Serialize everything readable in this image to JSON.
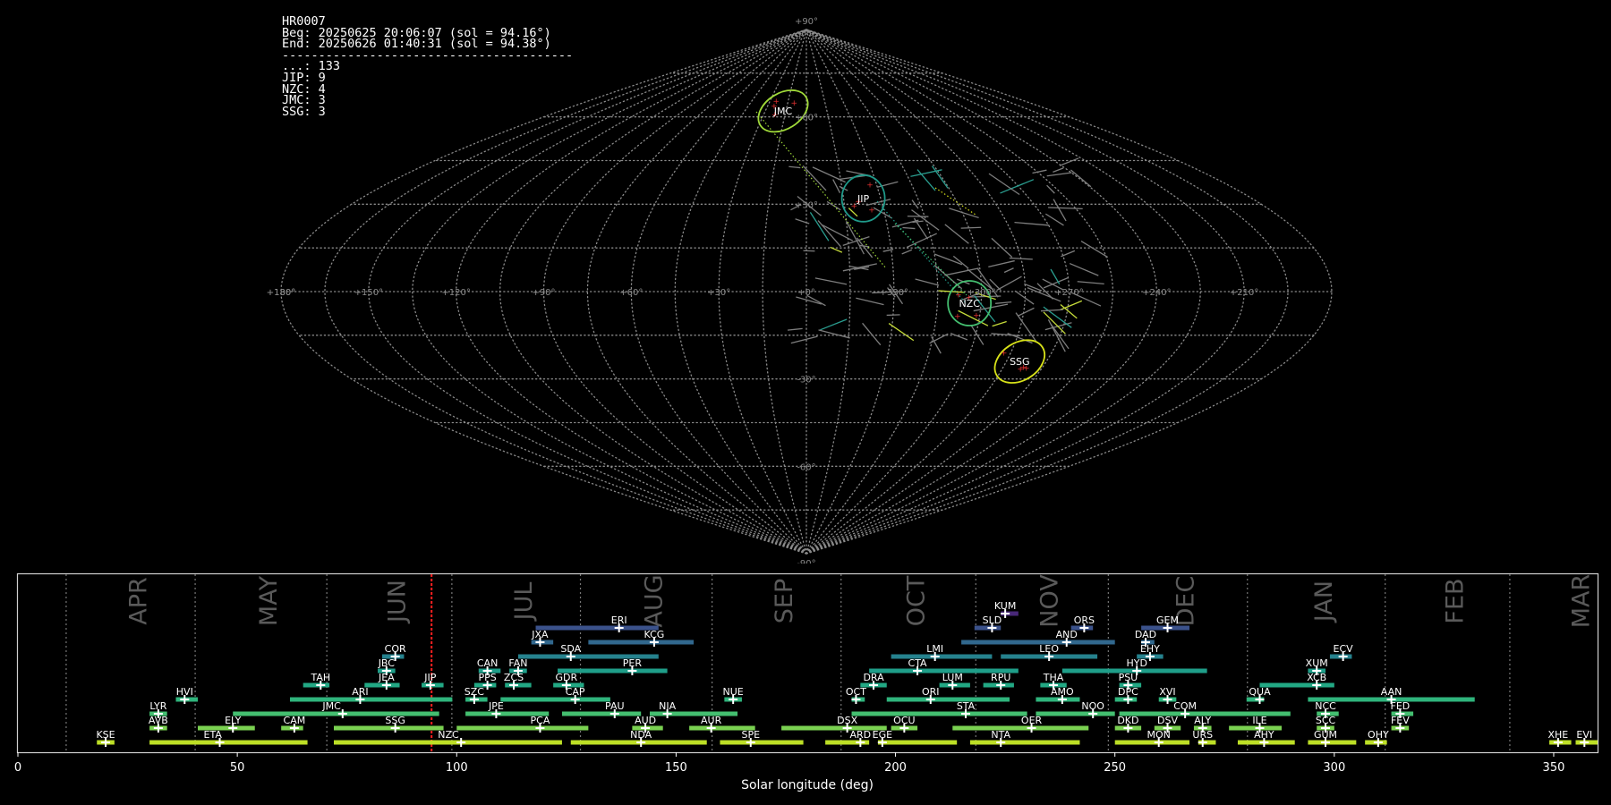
{
  "info": {
    "title": "HR0007",
    "beg": "Beg: 20250625 20:06:07 (sol = 94.16°)",
    "end": "End: 20250626 01:40:31 (sol = 94.38°)",
    "separator": "----------------------------------------",
    "counts": [
      {
        "label": "...",
        "value": 133
      },
      {
        "label": "JIP",
        "value": 9
      },
      {
        "label": "NZC",
        "value": 4
      },
      {
        "label": "JMC",
        "value": 3
      },
      {
        "label": "SSG",
        "value": 3
      }
    ]
  },
  "sky_map": {
    "projection": "sinusoidal",
    "lon_ticks": [
      "+180°",
      "+150°",
      "+120°",
      "+90°",
      "+60°",
      "+30°",
      "+0°",
      "+330°",
      "+300°",
      "+270°",
      "+240°",
      "+210°",
      "+180°"
    ],
    "lat_ticks": [
      "+90°",
      "+60°",
      "+30°",
      "-30°",
      "-60°",
      "-90°"
    ],
    "radiants": [
      {
        "code": "JMC",
        "lon": 17,
        "lat": 62,
        "color": "#a0da39"
      },
      {
        "code": "JIP",
        "lon": 337,
        "lat": 32,
        "color": "#1f9a8a"
      },
      {
        "code": "NZC",
        "lon": 304,
        "lat": -4,
        "color": "#44bf70"
      },
      {
        "code": "SSG",
        "lon": 280,
        "lat": -24,
        "color": "#d8e219"
      }
    ]
  },
  "chart_data": {
    "type": "timeline",
    "xlabel": "Solar longitude (deg)",
    "xlim": [
      0,
      360
    ],
    "xticks": [
      0,
      50,
      100,
      150,
      200,
      250,
      300,
      350
    ],
    "current_sol": 94.27,
    "months": [
      {
        "name": "APR",
        "start": 11.0
      },
      {
        "name": "MAY",
        "start": 40.4
      },
      {
        "name": "JUN",
        "start": 70.4
      },
      {
        "name": "JUL",
        "start": 98.9
      },
      {
        "name": "AUG",
        "start": 128.2
      },
      {
        "name": "SEP",
        "start": 158.2
      },
      {
        "name": "OCT",
        "start": 187.6
      },
      {
        "name": "NOV",
        "start": 218.3
      },
      {
        "name": "DEC",
        "start": 248.5
      },
      {
        "name": "JAN",
        "start": 280.2
      },
      {
        "name": "FEB",
        "start": 311.6
      },
      {
        "name": "MAR",
        "start": 340.0
      }
    ],
    "showers": [
      {
        "code": "KUM",
        "start": 224,
        "end": 228,
        "peak": 225,
        "row": 11,
        "color": "#482878"
      },
      {
        "code": "ERI",
        "start": 118,
        "end": 146,
        "peak": 137,
        "row": 10,
        "color": "#3b528b"
      },
      {
        "code": "SLD",
        "start": 218,
        "end": 224,
        "peak": 222,
        "row": 10,
        "color": "#3b528b"
      },
      {
        "code": "ORS",
        "start": 240,
        "end": 245,
        "peak": 243,
        "row": 10,
        "color": "#3b528b"
      },
      {
        "code": "GEM",
        "start": 256,
        "end": 267,
        "peak": 262,
        "row": 10,
        "color": "#3b528b"
      },
      {
        "code": "JXA",
        "start": 117,
        "end": 122,
        "peak": 119,
        "row": 9,
        "color": "#31688e"
      },
      {
        "code": "KCG",
        "start": 130,
        "end": 154,
        "peak": 145,
        "row": 9,
        "color": "#31688e"
      },
      {
        "code": "AND",
        "start": 215,
        "end": 250,
        "peak": 239,
        "row": 9,
        "color": "#31688e"
      },
      {
        "code": "DAD",
        "start": 256,
        "end": 259,
        "peak": 257,
        "row": 9,
        "color": "#31688e"
      },
      {
        "code": "COR",
        "start": 83,
        "end": 88,
        "peak": 86,
        "row": 8,
        "color": "#26828e"
      },
      {
        "code": "SDA",
        "start": 114,
        "end": 146,
        "peak": 126,
        "row": 8,
        "color": "#26828e"
      },
      {
        "code": "LMI",
        "start": 199,
        "end": 222,
        "peak": 209,
        "row": 8,
        "color": "#26828e"
      },
      {
        "code": "LEO",
        "start": 224,
        "end": 246,
        "peak": 235,
        "row": 8,
        "color": "#26828e"
      },
      {
        "code": "EHY",
        "start": 255,
        "end": 261,
        "peak": 258,
        "row": 8,
        "color": "#26828e"
      },
      {
        "code": "ECV",
        "start": 299,
        "end": 304,
        "peak": 302,
        "row": 8,
        "color": "#26828e"
      },
      {
        "code": "JBC",
        "start": 82,
        "end": 86,
        "peak": 84,
        "row": 7,
        "color": "#1f9e89"
      },
      {
        "code": "CAN",
        "start": 105,
        "end": 110,
        "peak": 107,
        "row": 7,
        "color": "#1f9e89"
      },
      {
        "code": "FAN",
        "start": 112,
        "end": 116,
        "peak": 114,
        "row": 7,
        "color": "#1f9e89"
      },
      {
        "code": "PER",
        "start": 123,
        "end": 148,
        "peak": 140,
        "row": 7,
        "color": "#1f9e89"
      },
      {
        "code": "CTA",
        "start": 194,
        "end": 228,
        "peak": 205,
        "row": 7,
        "color": "#1f9e89"
      },
      {
        "code": "HYD",
        "start": 238,
        "end": 271,
        "peak": 255,
        "row": 7,
        "color": "#1f9e89"
      },
      {
        "code": "XUM",
        "start": 294,
        "end": 298,
        "peak": 296,
        "row": 7,
        "color": "#1f9e89"
      },
      {
        "code": "TAH",
        "start": 65,
        "end": 71,
        "peak": 69,
        "row": 6,
        "color": "#22a884"
      },
      {
        "code": "JEA",
        "start": 79,
        "end": 87,
        "peak": 84,
        "row": 6,
        "color": "#22a884"
      },
      {
        "code": "JIP",
        "start": 92,
        "end": 97,
        "peak": 94,
        "row": 6,
        "color": "#22a884"
      },
      {
        "code": "PPS",
        "start": 104,
        "end": 109,
        "peak": 107,
        "row": 6,
        "color": "#22a884"
      },
      {
        "code": "ZCS",
        "start": 111,
        "end": 117,
        "peak": 113,
        "row": 6,
        "color": "#22a884"
      },
      {
        "code": "GDR",
        "start": 122,
        "end": 129,
        "peak": 125,
        "row": 6,
        "color": "#22a884"
      },
      {
        "code": "DRA",
        "start": 192,
        "end": 198,
        "peak": 195,
        "row": 6,
        "color": "#22a884"
      },
      {
        "code": "LUM",
        "start": 210,
        "end": 217,
        "peak": 213,
        "row": 6,
        "color": "#22a884"
      },
      {
        "code": "RPU",
        "start": 220,
        "end": 227,
        "peak": 224,
        "row": 6,
        "color": "#22a884"
      },
      {
        "code": "THA",
        "start": 233,
        "end": 239,
        "peak": 236,
        "row": 6,
        "color": "#22a884"
      },
      {
        "code": "PSU",
        "start": 251,
        "end": 256,
        "peak": 253,
        "row": 6,
        "color": "#22a884"
      },
      {
        "code": "XCB",
        "start": 283,
        "end": 300,
        "peak": 296,
        "row": 6,
        "color": "#22a884"
      },
      {
        "code": "HVI",
        "start": 36,
        "end": 41,
        "peak": 38,
        "row": 5,
        "color": "#2fb47c"
      },
      {
        "code": "ARI",
        "start": 62,
        "end": 99,
        "peak": 78,
        "row": 5,
        "color": "#2fb47c"
      },
      {
        "code": "SZC",
        "start": 102,
        "end": 107,
        "peak": 104,
        "row": 5,
        "color": "#2fb47c"
      },
      {
        "code": "CAP",
        "start": 110,
        "end": 135,
        "peak": 127,
        "row": 5,
        "color": "#2fb47c"
      },
      {
        "code": "NUE",
        "start": 161,
        "end": 165,
        "peak": 163,
        "row": 5,
        "color": "#2fb47c"
      },
      {
        "code": "OCT",
        "start": 190,
        "end": 193,
        "peak": 191,
        "row": 5,
        "color": "#2fb47c"
      },
      {
        "code": "ORI",
        "start": 198,
        "end": 226,
        "peak": 208,
        "row": 5,
        "color": "#2fb47c"
      },
      {
        "code": "AMO",
        "start": 232,
        "end": 242,
        "peak": 238,
        "row": 5,
        "color": "#2fb47c"
      },
      {
        "code": "DPC",
        "start": 250,
        "end": 255,
        "peak": 253,
        "row": 5,
        "color": "#2fb47c"
      },
      {
        "code": "XVI",
        "start": 260,
        "end": 264,
        "peak": 262,
        "row": 5,
        "color": "#2fb47c"
      },
      {
        "code": "QUA",
        "start": 280,
        "end": 284,
        "peak": 283,
        "row": 5,
        "color": "#2fb47c"
      },
      {
        "code": "AAN",
        "start": 294,
        "end": 332,
        "peak": 313,
        "row": 5,
        "color": "#2fb47c"
      },
      {
        "code": "LYR",
        "start": 30,
        "end": 34,
        "peak": 32,
        "row": 4,
        "color": "#44bf70"
      },
      {
        "code": "JMC",
        "start": 49,
        "end": 96,
        "peak": 74,
        "row": 4,
        "color": "#44bf70"
      },
      {
        "code": "JPE",
        "start": 102,
        "end": 121,
        "peak": 109,
        "row": 4,
        "color": "#44bf70"
      },
      {
        "code": "PAU",
        "start": 124,
        "end": 142,
        "peak": 136,
        "row": 4,
        "color": "#44bf70"
      },
      {
        "code": "NIA",
        "start": 144,
        "end": 164,
        "peak": 148,
        "row": 4,
        "color": "#44bf70"
      },
      {
        "code": "STA",
        "start": 190,
        "end": 230,
        "peak": 216,
        "row": 4,
        "color": "#44bf70"
      },
      {
        "code": "NOO",
        "start": 232,
        "end": 250,
        "peak": 245,
        "row": 4,
        "color": "#44bf70"
      },
      {
        "code": "COM",
        "start": 251,
        "end": 290,
        "peak": 266,
        "row": 4,
        "color": "#44bf70"
      },
      {
        "code": "NCC",
        "start": 296,
        "end": 301,
        "peak": 298,
        "row": 4,
        "color": "#44bf70"
      },
      {
        "code": "FED",
        "start": 313,
        "end": 318,
        "peak": 315,
        "row": 4,
        "color": "#44bf70"
      },
      {
        "code": "AVB",
        "start": 30,
        "end": 34,
        "peak": 32,
        "row": 3,
        "color": "#7ad151"
      },
      {
        "code": "ELY",
        "start": 41,
        "end": 54,
        "peak": 49,
        "row": 3,
        "color": "#7ad151"
      },
      {
        "code": "CAM",
        "start": 60,
        "end": 65,
        "peak": 63,
        "row": 3,
        "color": "#7ad151"
      },
      {
        "code": "SSG",
        "start": 72,
        "end": 97,
        "peak": 86,
        "row": 3,
        "color": "#7ad151"
      },
      {
        "code": "PCA",
        "start": 100,
        "end": 130,
        "peak": 119,
        "row": 3,
        "color": "#7ad151"
      },
      {
        "code": "AUD",
        "start": 140,
        "end": 147,
        "peak": 143,
        "row": 3,
        "color": "#7ad151"
      },
      {
        "code": "AUR",
        "start": 153,
        "end": 168,
        "peak": 158,
        "row": 3,
        "color": "#7ad151"
      },
      {
        "code": "DSX",
        "start": 174,
        "end": 198,
        "peak": 189,
        "row": 3,
        "color": "#7ad151"
      },
      {
        "code": "OCU",
        "start": 199,
        "end": 205,
        "peak": 202,
        "row": 3,
        "color": "#7ad151"
      },
      {
        "code": "OER",
        "start": 213,
        "end": 244,
        "peak": 231,
        "row": 3,
        "color": "#7ad151"
      },
      {
        "code": "DKD",
        "start": 250,
        "end": 256,
        "peak": 253,
        "row": 3,
        "color": "#7ad151"
      },
      {
        "code": "DSV",
        "start": 259,
        "end": 265,
        "peak": 262,
        "row": 3,
        "color": "#7ad151"
      },
      {
        "code": "ALY",
        "start": 268,
        "end": 272,
        "peak": 270,
        "row": 3,
        "color": "#7ad151"
      },
      {
        "code": "ILE",
        "start": 276,
        "end": 288,
        "peak": 283,
        "row": 3,
        "color": "#7ad151"
      },
      {
        "code": "SCC",
        "start": 296,
        "end": 300,
        "peak": 298,
        "row": 3,
        "color": "#7ad151"
      },
      {
        "code": "FEV",
        "start": 313,
        "end": 317,
        "peak": 315,
        "row": 3,
        "color": "#7ad151"
      },
      {
        "code": "KSE",
        "start": 18,
        "end": 22,
        "peak": 20,
        "row": 2,
        "color": "#bddf26"
      },
      {
        "code": "ETA",
        "start": 30,
        "end": 66,
        "peak": 46,
        "row": 2,
        "color": "#bddf26"
      },
      {
        "code": "NZC",
        "start": 72,
        "end": 124,
        "peak": 101,
        "row": 2,
        "color": "#bddf26"
      },
      {
        "code": "NDA",
        "start": 126,
        "end": 157,
        "peak": 142,
        "row": 2,
        "color": "#bddf26"
      },
      {
        "code": "SPE",
        "start": 160,
        "end": 179,
        "peak": 167,
        "row": 2,
        "color": "#bddf26"
      },
      {
        "code": "ARD",
        "start": 184,
        "end": 194,
        "peak": 192,
        "row": 2,
        "color": "#bddf26"
      },
      {
        "code": "EGE",
        "start": 196,
        "end": 214,
        "peak": 197,
        "row": 2,
        "color": "#bddf26"
      },
      {
        "code": "NTA",
        "start": 217,
        "end": 242,
        "peak": 224,
        "row": 2,
        "color": "#bddf26"
      },
      {
        "code": "MON",
        "start": 250,
        "end": 267,
        "peak": 260,
        "row": 2,
        "color": "#bddf26"
      },
      {
        "code": "URS",
        "start": 269,
        "end": 273,
        "peak": 270,
        "row": 2,
        "color": "#bddf26"
      },
      {
        "code": "AHY",
        "start": 278,
        "end": 291,
        "peak": 284,
        "row": 2,
        "color": "#bddf26"
      },
      {
        "code": "GUM",
        "start": 294,
        "end": 305,
        "peak": 298,
        "row": 2,
        "color": "#bddf26"
      },
      {
        "code": "OHY",
        "start": 307,
        "end": 312,
        "peak": 310,
        "row": 2,
        "color": "#bddf26"
      },
      {
        "code": "XHE",
        "start": 349,
        "end": 354,
        "peak": 351,
        "row": 2,
        "color": "#bddf26"
      },
      {
        "code": "EVI",
        "start": 355,
        "end": 360,
        "peak": 357,
        "row": 2,
        "color": "#bddf26"
      }
    ]
  }
}
